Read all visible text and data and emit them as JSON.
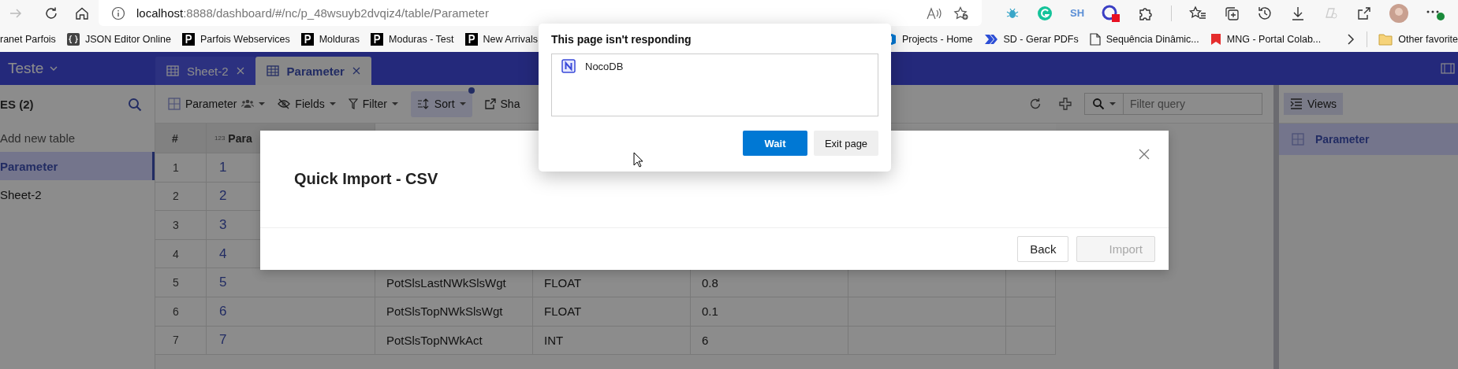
{
  "browser": {
    "url_host": "localhost",
    "url_path": ":8888/dashboard/#/nc/p_48wsuyb2dvqiz4/table/Parameter",
    "extension_label": "SH",
    "bookmarks": [
      {
        "label": "ranet Parfois",
        "kind": "plain"
      },
      {
        "label": "JSON Editor Online",
        "kind": "braces"
      },
      {
        "label": "Parfois Webservices",
        "kind": "letter"
      },
      {
        "label": "Molduras",
        "kind": "letter"
      },
      {
        "label": "Moduras - Test",
        "kind": "letter"
      },
      {
        "label": "New Arrivals",
        "kind": "letter"
      },
      {
        "label": "Projects - Home",
        "kind": "devops"
      },
      {
        "label": "SD - Gerar PDFs",
        "kind": "chevrons"
      },
      {
        "label": "Sequência Dinâmic...",
        "kind": "page"
      },
      {
        "label": "MNG - Portal Colab...",
        "kind": "ribbon"
      }
    ],
    "other_favorites": "Other favorite"
  },
  "app": {
    "project": "Teste",
    "tabs": [
      {
        "label": "Sheet-2",
        "selected": false
      },
      {
        "label": "Parameter",
        "selected": true
      }
    ],
    "sidebar": {
      "heading": "ES (2)",
      "add_label": "Add new table",
      "items": [
        {
          "label": "Parameter",
          "selected": true
        },
        {
          "label": "Sheet-2",
          "selected": false
        }
      ]
    },
    "toolbar": {
      "view": "Parameter",
      "fields": "Fields",
      "filter": "Filter",
      "sort": "Sort",
      "sort_active": true,
      "share": "Sha",
      "search_placeholder": "Filter query"
    },
    "table": {
      "columns": [
        {
          "label": "#"
        },
        {
          "label": "Para",
          "type_badge": "123"
        }
      ],
      "rows": [
        {
          "index": "1",
          "id": "1"
        },
        {
          "index": "2",
          "id": "2"
        },
        {
          "index": "3",
          "id": "3"
        },
        {
          "index": "4",
          "id": "4"
        },
        {
          "index": "5",
          "id": "5",
          "column_3": "PotSlsLastNWkSlsWgt",
          "column_4": "FLOAT",
          "column_5": "0.8"
        },
        {
          "index": "6",
          "id": "6",
          "column_3": "PotSlsTopNWkSlsWgt",
          "column_4": "FLOAT",
          "column_5": "0.1"
        },
        {
          "index": "7",
          "id": "7",
          "column_3": "PotSlsTopNWkAct",
          "column_4": "INT",
          "column_5": "6"
        }
      ]
    },
    "views": {
      "button": "Views",
      "items": [
        {
          "label": "Parameter",
          "selected": true
        }
      ]
    }
  },
  "modal": {
    "title": "Quick Import - CSV",
    "buttons": [
      {
        "label": "Back",
        "disabled": false
      },
      {
        "label": "Import",
        "disabled": true
      }
    ]
  },
  "dialog": {
    "title": "This page isn't responding",
    "pages": [
      {
        "label": "NocoDB"
      }
    ],
    "buttons": [
      {
        "label": "Wait",
        "kind": "primary"
      },
      {
        "label": "Exit page",
        "kind": "secondary"
      }
    ]
  }
}
